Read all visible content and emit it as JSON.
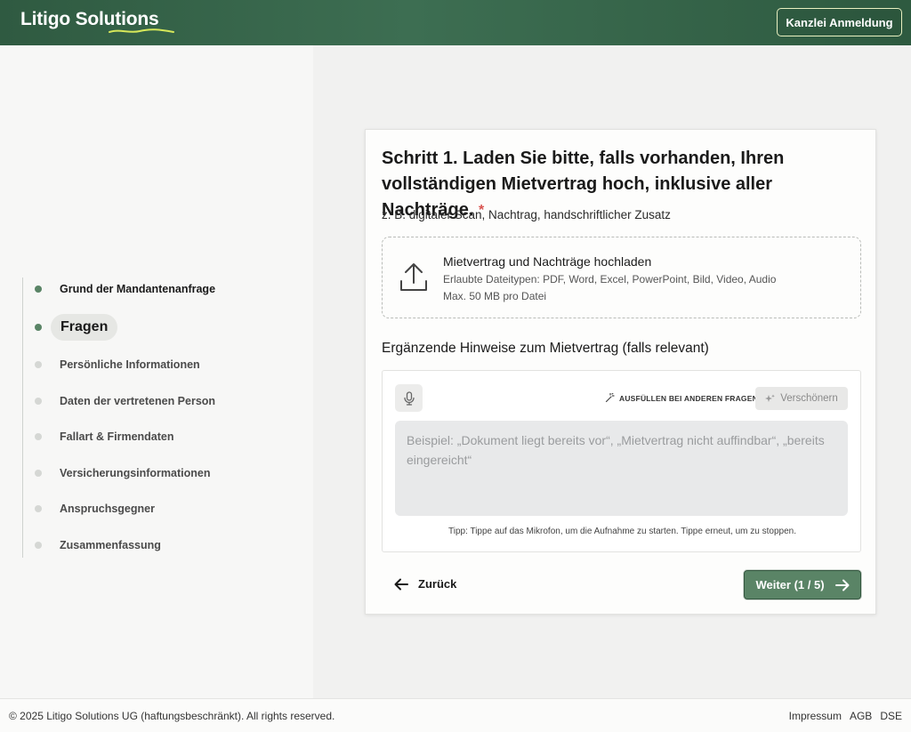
{
  "header": {
    "logo": "Litigo Solutions",
    "login_button": "Kanzlei Anmeldung"
  },
  "sidebar": {
    "steps": [
      {
        "label": "Grund der Mandantenanfrage",
        "state": "done"
      },
      {
        "label": "Fragen",
        "state": "active"
      },
      {
        "label": "Persönliche Informationen",
        "state": "pending"
      },
      {
        "label": "Daten der vertretenen Person",
        "state": "pending"
      },
      {
        "label": "Fallart & Firmendaten",
        "state": "pending"
      },
      {
        "label": "Versicherungsinformationen",
        "state": "pending"
      },
      {
        "label": "Anspruchsgegner",
        "state": "pending"
      },
      {
        "label": "Zusammenfassung",
        "state": "pending"
      }
    ]
  },
  "question": {
    "title": "Schritt 1. Laden Sie bitte, falls vorhanden, Ihren vollständigen Mietvertrag hoch, inklusive aller Nachträge.",
    "required_marker": "*",
    "subtitle": "z. B. digitaler Scan, Nachtrag, handschriftlicher Zusatz"
  },
  "upload": {
    "title": "Mietvertrag und Nachträge hochladen",
    "types": "Erlaubte Dateitypen: PDF, Word, Excel, PowerPoint, Bild, Video, Audio",
    "max_size": "Max. 50 MB pro Datei",
    "icon": "upload-icon"
  },
  "notes": {
    "label": "Ergänzende Hinweise zum Mietvertrag (falls relevant)",
    "fill_button": "AUSFÜLLEN BEI ANDEREN FRAGEN",
    "beautify_button": "Verschönern",
    "placeholder": "Beispiel: „Dokument liegt bereits vor“, „Mietvertrag nicht auffindbar“, „bereits eingereicht“",
    "tip": "Tipp: Tippe auf das Mikrofon, um die Aufnahme zu starten. Tippe erneut, um zu stoppen."
  },
  "nav": {
    "back": "Zurück",
    "next": "Weiter (1 / 5)"
  },
  "footer": {
    "copyright": "© 2025 Litigo Solutions UG (haftungsbeschränkt). All rights reserved.",
    "links": [
      "Impressum",
      "AGB",
      "DSE"
    ]
  },
  "colors": {
    "brand_green": "#3d6e52",
    "accent_green": "#5a8466",
    "required_red": "#d9534f"
  }
}
